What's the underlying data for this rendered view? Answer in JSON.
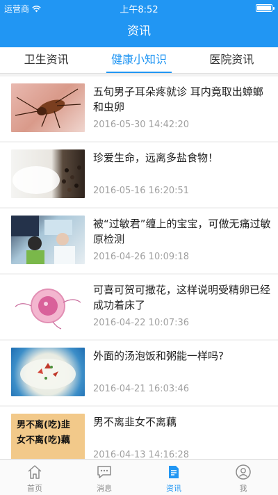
{
  "status_bar": {
    "carrier": "运营商",
    "time": "上午8:52"
  },
  "nav": {
    "title": "资讯"
  },
  "tabs": [
    {
      "label": "卫生资讯"
    },
    {
      "label": "健康小知识"
    },
    {
      "label": "医院资讯"
    }
  ],
  "articles": [
    {
      "title": "五旬男子耳朵疼就诊  耳内竟取出蟑螂和虫卵",
      "date": "2016-05-30 14:42:20"
    },
    {
      "title": "珍爱生命，远离多盐食物！",
      "date": "2016-05-16 16:20:51"
    },
    {
      "title": "被“过敏君”缠上的宝宝，可做无痛过敏原检测",
      "date": "2016-04-26 10:09:18"
    },
    {
      "title": "可喜可贺可撒花，这样说明受精卵已经成功着床了",
      "date": "2016-04-22 10:07:36"
    },
    {
      "title": "外面的汤泡饭和粥能一样吗?",
      "date": "2016-04-21 16:03:46"
    },
    {
      "title": "男不离韭女不离藕",
      "date": "2016-04-13 14:16:28",
      "image_text": [
        "男不离(吃)韭",
        "女不离(吃)藕"
      ]
    }
  ],
  "tabbar": [
    {
      "label": "首页",
      "icon": "home-icon"
    },
    {
      "label": "消息",
      "icon": "message-icon"
    },
    {
      "label": "资讯",
      "icon": "news-icon"
    },
    {
      "label": "我",
      "icon": "user-icon"
    }
  ],
  "colors": {
    "accent": "#2196f3",
    "inactive": "#8a8a8a",
    "date": "#a0a0a0"
  }
}
